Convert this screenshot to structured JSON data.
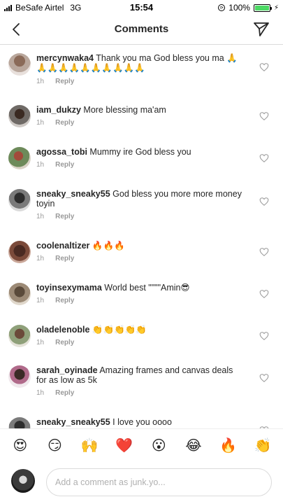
{
  "status": {
    "carrier": "BeSafe Airtel",
    "network": "3G",
    "time": "15:54",
    "battery": "100%",
    "battery_level": 1.0
  },
  "nav": {
    "title": "Comments",
    "back_icon": "chevron-left-icon",
    "send_icon": "paper-plane-icon"
  },
  "comments": [
    {
      "user": "mercynwaka4",
      "text": "Thank you ma God bless you ma 🙏🙏🙏🙏🙏🙏🙏🙏🙏🙏🙏",
      "time": "1h",
      "reply": "Reply"
    },
    {
      "user": "iam_dukzy",
      "text": "More blessing ma'am",
      "time": "1h",
      "reply": "Reply"
    },
    {
      "user": "agossa_tobi",
      "text": "Mummy ire God bless you",
      "time": "1h",
      "reply": "Reply"
    },
    {
      "user": "sneaky_sneaky55",
      "text": "God bless you more more money toyin",
      "time": "1h",
      "reply": "Reply"
    },
    {
      "user": "coolenaltizer",
      "text": "🔥🔥🔥",
      "time": "1h",
      "reply": "Reply"
    },
    {
      "user": "toyinsexymama",
      "text": "World best \"\"\"\"Amin😎",
      "time": "1h",
      "reply": "Reply"
    },
    {
      "user": "oladelenoble",
      "text": "👏👏👏👏👏",
      "time": "1h",
      "reply": "Reply"
    },
    {
      "user": "sarah_oyinade",
      "text": "Amazing frames and canvas deals for as low as 5k",
      "time": "1h",
      "reply": "Reply"
    },
    {
      "user": "sneaky_sneaky55",
      "text": "I love you oooo",
      "time": "",
      "reply": ""
    }
  ],
  "emoji_bar": [
    "😍",
    "😏",
    "🙌",
    "❤️",
    "😮",
    "😂",
    "🔥",
    "👏"
  ],
  "input": {
    "placeholder": "Add a comment as junk.yo..."
  },
  "colors": {
    "text": "#262626",
    "muted": "#999999",
    "border": "#dbdbdb",
    "battery": "#4cd964"
  }
}
